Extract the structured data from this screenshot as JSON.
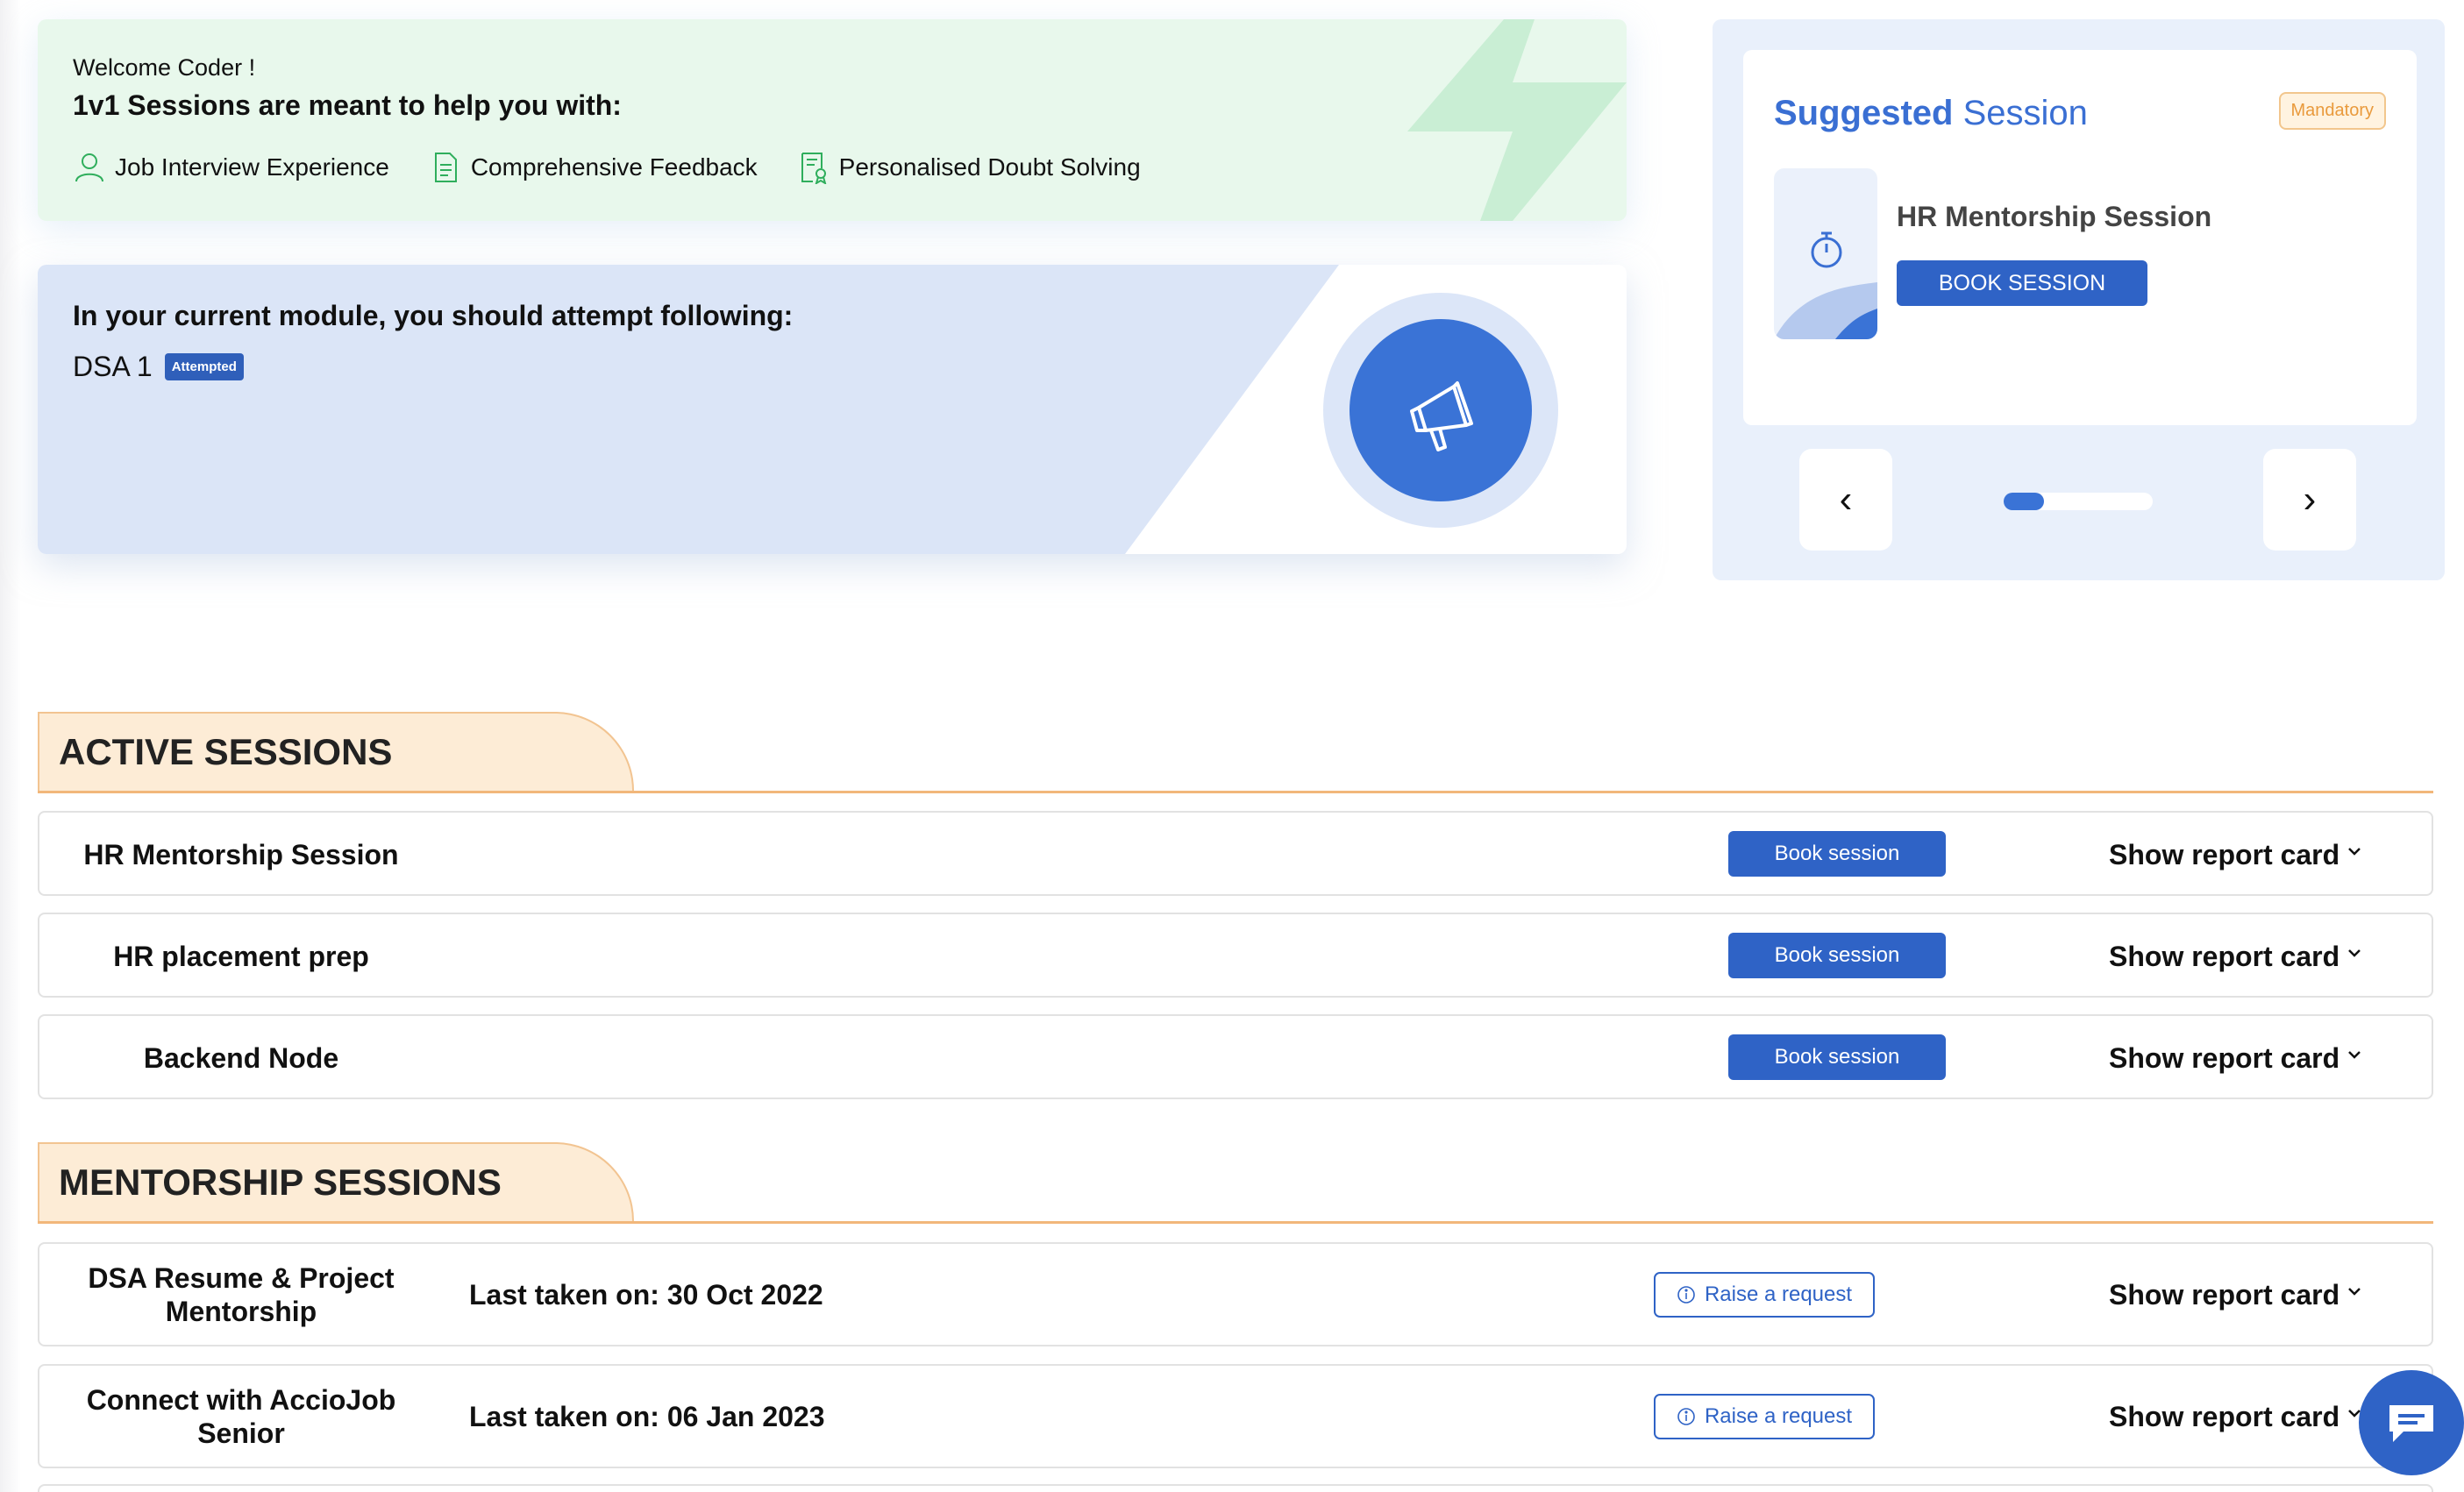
{
  "welcome": {
    "greeting": "Welcome Coder !",
    "heading": "1v1 Sessions are meant to help you with:",
    "features": [
      {
        "label": "Job Interview Experience",
        "icon": "user-icon"
      },
      {
        "label": "Comprehensive Feedback",
        "icon": "document-icon"
      },
      {
        "label": "Personalised Doubt Solving",
        "icon": "certificate-icon"
      }
    ]
  },
  "module": {
    "title": "In your current module, you should attempt following:",
    "item": {
      "name": "DSA 1",
      "badge": "Attempted"
    },
    "icon": "megaphone-icon"
  },
  "suggested": {
    "title_bold": "Suggested",
    "title_rest": " Session",
    "tag": "Mandatory",
    "session_name": "HR Mentorship Session",
    "book_label": "BOOK SESSION",
    "prev": "‹",
    "next": "›",
    "icon": "stopwatch-icon"
  },
  "active_sessions": {
    "heading": "ACTIVE SESSIONS",
    "rows": [
      {
        "name": "HR Mentorship Session",
        "action": "Book session",
        "report": "Show report card"
      },
      {
        "name": "HR placement prep",
        "action": "Book session",
        "report": "Show report card"
      },
      {
        "name": "Backend Node",
        "action": "Book session",
        "report": "Show report card"
      }
    ]
  },
  "mentorship_sessions": {
    "heading": "MENTORSHIP SESSIONS",
    "rows": [
      {
        "name_line1": "DSA Resume & Project",
        "name_line2": "Mentorship",
        "last_taken": "Last taken on: 30 Oct 2022",
        "action": "Raise a request",
        "report": "Show report card"
      },
      {
        "name_line1": "Connect with AccioJob",
        "name_line2": "Senior",
        "last_taken": "Last taken on: 06 Jan 2023",
        "action": "Raise a request",
        "report": "Show report card"
      }
    ]
  },
  "colors": {
    "primary": "#2f63c6",
    "accent_orange": "#f2b77a",
    "green_bg": "#e8f8ec",
    "module_blue": "#dbe5f7"
  }
}
